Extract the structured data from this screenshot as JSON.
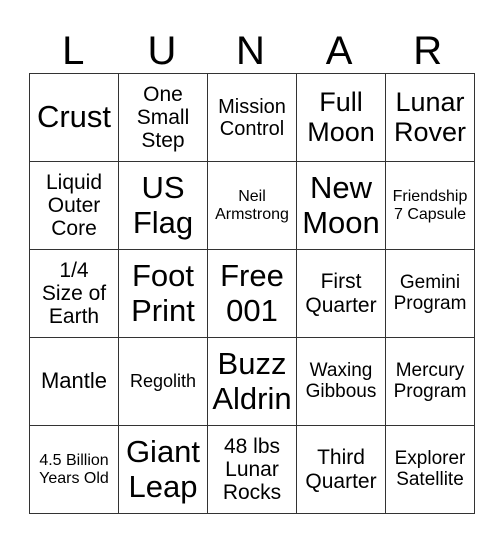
{
  "header": [
    "L",
    "U",
    "N",
    "A",
    "R"
  ],
  "rows": [
    [
      "Crust",
      "One\nSmall\nStep",
      "Mission\nControl",
      "Full\nMoon",
      "Lunar\nRover"
    ],
    [
      "Liquid\nOuter\nCore",
      "US\nFlag",
      "Neil\nArmstrong",
      "New\nMoon",
      "Friendship\n7 Capsule"
    ],
    [
      "1/4\nSize of\nEarth",
      "Foot\nPrint",
      "Free\n001",
      "First\nQuarter",
      "Gemini\nProgram"
    ],
    [
      "Mantle",
      "Regolith",
      "Buzz\nAldrin",
      "Waxing\nGibbous",
      "Mercury\nProgram"
    ],
    [
      "4.5 Billion\nYears Old",
      "Giant\nLeap",
      "48 lbs\nLunar\nRocks",
      "Third\nQuarter",
      "Explorer\nSatellite"
    ]
  ]
}
